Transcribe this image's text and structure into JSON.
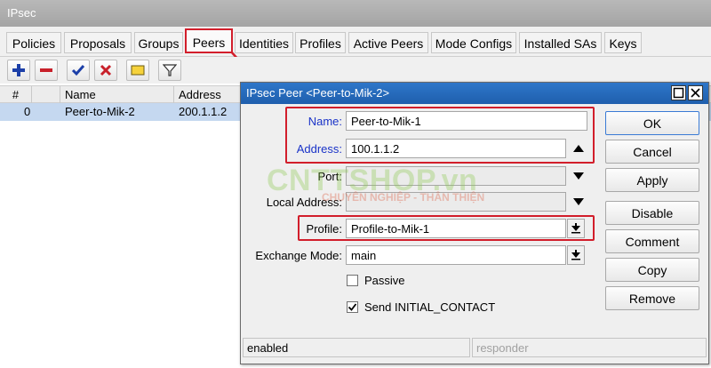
{
  "window": {
    "title": "IPsec"
  },
  "tabs": [
    {
      "label": "Policies"
    },
    {
      "label": "Proposals"
    },
    {
      "label": "Groups"
    },
    {
      "label": "Peers"
    },
    {
      "label": "Identities"
    },
    {
      "label": "Profiles"
    },
    {
      "label": "Active Peers"
    },
    {
      "label": "Mode Configs"
    },
    {
      "label": "Installed SAs"
    },
    {
      "label": "Keys"
    }
  ],
  "table": {
    "columns": [
      {
        "label": "#"
      },
      {
        "label": ""
      },
      {
        "label": "Name"
      },
      {
        "label": "Address"
      }
    ],
    "rows": [
      {
        "index": "0",
        "name": "Peer-to-Mik-2",
        "address": "200.1.1.2"
      }
    ]
  },
  "dialog": {
    "title": "IPsec Peer <Peer-to-Mik-2>",
    "fields": {
      "name": {
        "label": "Name:",
        "value": "Peer-to-Mik-1"
      },
      "address": {
        "label": "Address:",
        "value": "100.1.1.2"
      },
      "port": {
        "label": "Port:",
        "value": ""
      },
      "local_address": {
        "label": "Local Address:",
        "value": ""
      },
      "profile": {
        "label": "Profile:",
        "value": "Profile-to-Mik-1"
      },
      "exchange_mode": {
        "label": "Exchange Mode:",
        "value": "main"
      }
    },
    "checkboxes": {
      "passive": {
        "label": "Passive",
        "checked": false
      },
      "send_initial_contact": {
        "label": "Send INITIAL_CONTACT",
        "checked": true
      }
    },
    "buttons": {
      "ok": "OK",
      "cancel": "Cancel",
      "apply": "Apply",
      "disable": "Disable",
      "comment": "Comment",
      "copy": "Copy",
      "remove": "Remove"
    },
    "status": {
      "left": "enabled",
      "right": "responder"
    }
  },
  "watermark": {
    "main": "CNTTSHOP.vn",
    "sub": "CHUYÊN NGHIỆP - THÂN THIỆN"
  },
  "colors": {
    "highlight": "#d21e2b",
    "selection": "#c5d8f0",
    "dialog_title": "#2e76c9",
    "label_blue": "#1a33c8"
  },
  "icons": [
    "add-icon",
    "remove-icon",
    "enable-check-icon",
    "disable-x-icon",
    "comment-icon",
    "filter-icon"
  ]
}
